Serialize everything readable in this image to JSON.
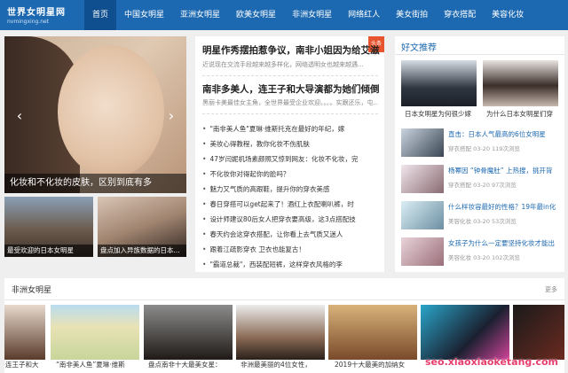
{
  "site": {
    "logo_text": "世界女明星网",
    "logo_url": "nvmingxing.net"
  },
  "nav": [
    "首页",
    "中国女明星",
    "亚洲女明星",
    "欧美女明星",
    "非洲女明星",
    "网络红人",
    "美女街拍",
    "穿衣搭配",
    "美容化妆"
  ],
  "hero": {
    "caption": "化妆和不化妆的皮肤，区别到底有多",
    "prev": "‹",
    "next": "›"
  },
  "thumbs": [
    "最受欢迎的日本女明星",
    "盘点加入异族数据的日本..."
  ],
  "news": {
    "badge": "头条",
    "headline1": "明星作秀摆拍惹争议，南非小姐因为给艾滋儿",
    "sub1": "近说现在交流手段越来越多样化，网络透明女也越来越遇...",
    "headline2": "南非多美人，连王子和大导演都为她们倾倒",
    "sub2": "黑丽卡美最佳女主角，全世界最受企业欢迎。。。。实跟还乐，屯...",
    "items": [
      "\"南非美人鱼\"夏琳·维斯托克在最好的年纪，嫁",
      "美妆心得教程，教你化妆不伤肌肤",
      "47岁闫妮机场素颜照又惊到网友：化妆不化妆，完",
      "不化妆你对得起你的脸吗？",
      "魅力又气质的高跟鞋，提升你的穿衣美感",
      "春日穿搭可以get起来了！酒红上衣配喇叭裤，时",
      "设计师建议80后女人把穿衣要高级，这3点搭配技",
      "春天约会这穿衣搭配，让你看上去气质又迷人",
      "跟着江疏影穿衣 卫衣也能复古！",
      "\"霸道总裁\"，西装配短裤，这样穿衣风格的李"
    ]
  },
  "side": {
    "head": "好文推荐",
    "top_labels": [
      "日本女明星为何很少嫁",
      "为什么日本女明星们穿"
    ],
    "rows": [
      {
        "title": "直击：日本人气最高的6位女明星",
        "meta": "穿衣搭配  03-20  119次浏览"
      },
      {
        "title": "杨幂因 “钟骨魔肚” 上热搜，挑开背",
        "meta": "穿衣搭配  03-20  97次浏览"
      },
      {
        "title": "什么样妆容最好的性格？19年最in化",
        "meta": "美容化妆  03-20  53次浏览"
      },
      {
        "title": "女孩子为什么一定要坚持化妆才能出",
        "meta": "美容化妆  03-20  102次浏览"
      }
    ]
  },
  "strip": {
    "title": "非洲女明星",
    "more": "更多",
    "items": [
      "连王子和大",
      "“南非美人鱼”夏琳·维斯",
      "盘点南非十大最美女星：",
      "非洲最美丽的4位女性，",
      "2019十大最美的加纳女",
      "",
      ""
    ]
  },
  "watermark": "seo.xiaoxiaoketang.com"
}
